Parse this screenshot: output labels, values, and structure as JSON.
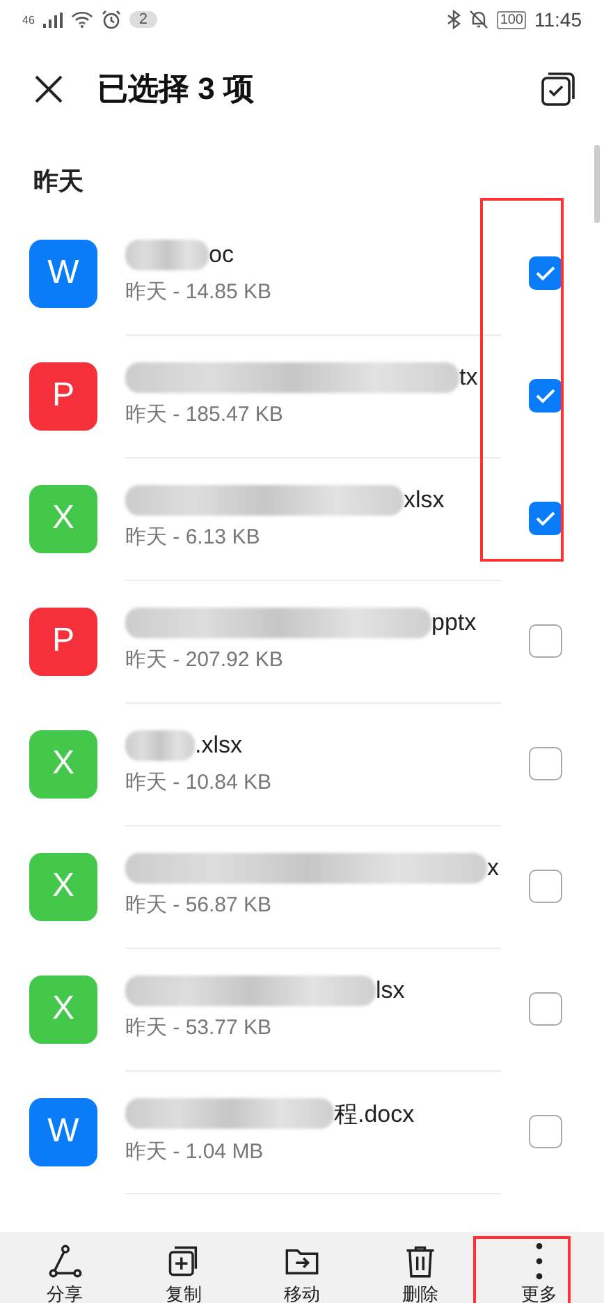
{
  "status_bar": {
    "network": "46",
    "notifications": "2",
    "battery": "100",
    "time": "11:45"
  },
  "header": {
    "title": "已选择 3 项"
  },
  "section": {
    "title": "昨天"
  },
  "files": [
    {
      "kind": "word",
      "letter": "W",
      "name_visible": "oc",
      "meta": "昨天 - 14.85 KB",
      "checked": true
    },
    {
      "kind": "powerpoint",
      "letter": "P",
      "name_visible": "tx",
      "meta": "昨天 - 185.47 KB",
      "checked": true
    },
    {
      "kind": "excel",
      "letter": "X",
      "name_visible": "xlsx",
      "meta": "昨天 - 6.13 KB",
      "checked": true
    },
    {
      "kind": "powerpoint",
      "letter": "P",
      "name_visible": "pptx",
      "meta": "昨天 - 207.92 KB",
      "checked": false
    },
    {
      "kind": "excel",
      "letter": "X",
      "name_visible": ".xlsx",
      "meta": "昨天 - 10.84 KB",
      "checked": false
    },
    {
      "kind": "excel",
      "letter": "X",
      "name_visible": "x",
      "meta": "昨天 - 56.87 KB",
      "checked": false
    },
    {
      "kind": "excel",
      "letter": "X",
      "name_visible": "lsx",
      "meta": "昨天 - 53.77 KB",
      "checked": false
    },
    {
      "kind": "word",
      "letter": "W",
      "name_visible": "程.docx",
      "meta": "昨天 - 1.04 MB",
      "checked": false
    }
  ],
  "toolbar": [
    {
      "kind": "share",
      "label": "分享"
    },
    {
      "kind": "copy",
      "label": "复制"
    },
    {
      "kind": "move",
      "label": "移动"
    },
    {
      "kind": "delete",
      "label": "删除"
    },
    {
      "kind": "more",
      "label": "更多"
    }
  ]
}
